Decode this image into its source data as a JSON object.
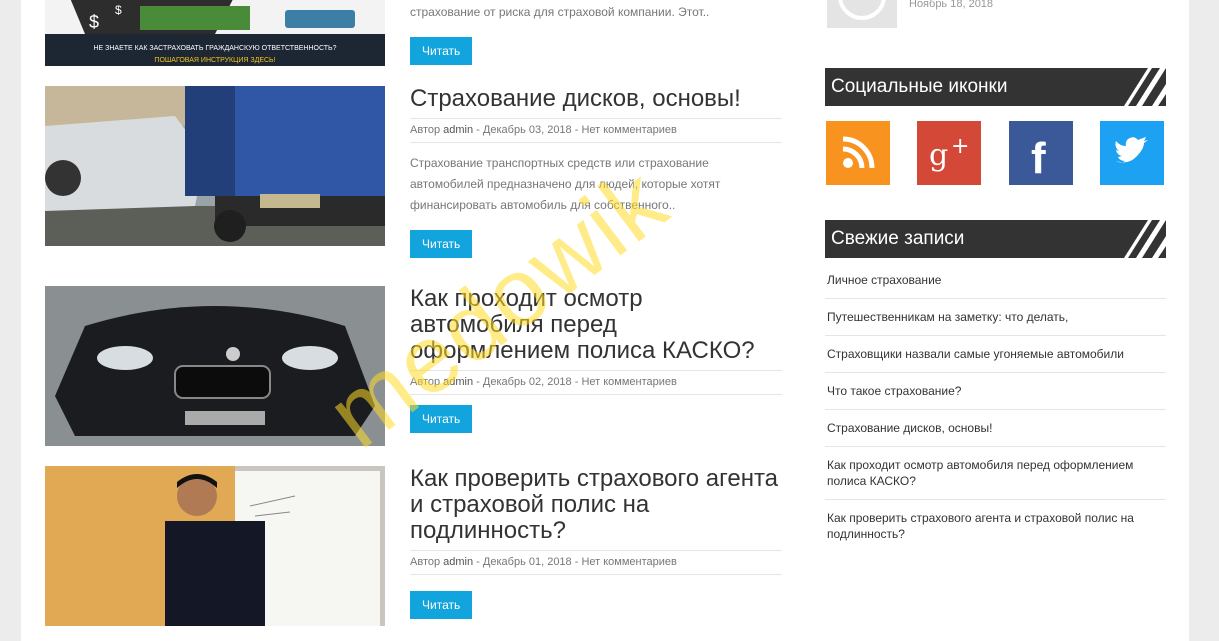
{
  "posts": [
    {
      "excerpt": "страхование от риска для страховой компании. Этот..",
      "read_label": "Читать",
      "thumb_caption_1": "НЕ ЗНАЕТЕ КАК ЗАСТРАХОВАТЬ ГРАЖДАНСКУЮ ОТВЕТСТВЕННОСТЬ?",
      "thumb_caption_2": "ПОШАГОВАЯ ИНСТРУКЦИЯ ЗДЕСЬ!"
    },
    {
      "title": "Страхование дисков, основы!",
      "author": "admin",
      "meta_prefix": "Автор",
      "date": "Декабрь 03, 2018",
      "comments": "Нет комментариев",
      "excerpt": "Страхование транспортных средств или страхование автомобилей предназначено для людей, которые хотят финансировать автомобиль для собственного..",
      "read_label": "Читать"
    },
    {
      "title": "Как проходит осмотр автомобиля перед оформлением полиса КАСКО?",
      "author": "admin",
      "meta_prefix": "Автор",
      "date": "Декабрь 02, 2018",
      "comments": "Нет комментариев",
      "read_label": "Читать"
    },
    {
      "title": "Как проверить страхового агента и страховой полис на подлинность?",
      "author": "admin",
      "meta_prefix": "Автор",
      "date": "Декабрь 01, 2018",
      "comments": "Нет комментариев",
      "read_label": "Читать"
    }
  ],
  "sidebar": {
    "top_date": "Ноябрь 18, 2018",
    "social_title": "Социальные иконки",
    "recent_title": "Свежие записи",
    "socials": [
      {
        "name": "rss",
        "color": "#f7931e"
      },
      {
        "name": "google-plus",
        "color": "#d34836"
      },
      {
        "name": "facebook",
        "color": "#3b5998"
      },
      {
        "name": "twitter",
        "color": "#1da1f2"
      }
    ],
    "recent": [
      "Личное страхование",
      "Путешественникам на заметку: что делать,",
      "Страховщики назвали самые угоняемые автомобили",
      "Что такое страхование?",
      "Страхование дисков, основы!",
      "Как проходит осмотр автомобиля перед оформлением полиса КАСКО?",
      "Как проверить страхового агента и страховой полис на подлинность?"
    ]
  },
  "watermark": "medowik",
  "accent_color": "#12a4dc"
}
